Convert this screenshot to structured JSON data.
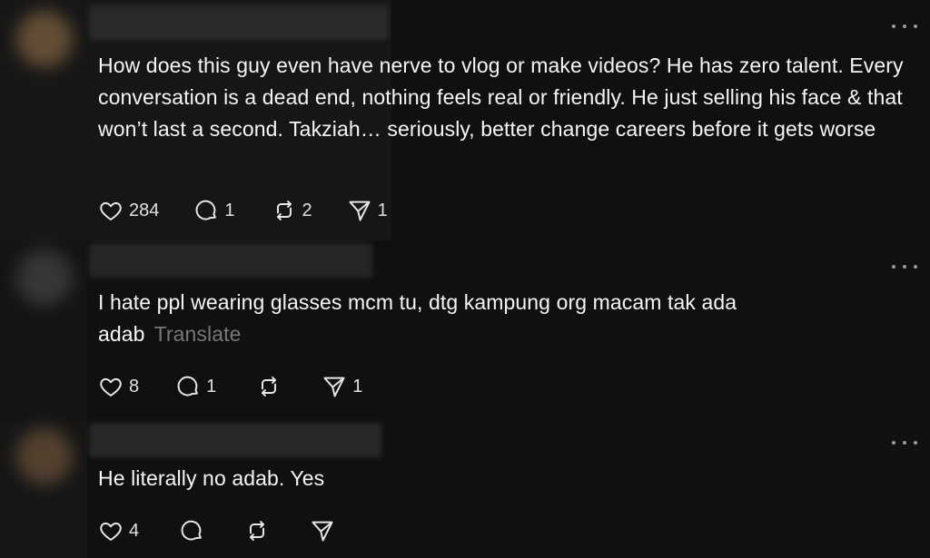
{
  "posts": [
    {
      "text": "How does this guy even have nerve to vlog or make videos? He has zero talent. Every conversation is a dead end, nothing feels real or friendly. He just selling his face & that won’t last a second. Takziah… seriously, better change careers before it gets worse",
      "translate_label": "",
      "likes": "284",
      "replies": "1",
      "reposts": "2",
      "shares": "1"
    },
    {
      "text": "I hate ppl wearing glasses mcm tu, dtg kampung org macam tak ada adab",
      "translate_label": "Translate",
      "likes": "8",
      "replies": "1",
      "reposts": "",
      "shares": "1"
    },
    {
      "text": "He literally no adab. Yes",
      "translate_label": "",
      "likes": "4",
      "replies": "",
      "reposts": "",
      "shares": ""
    }
  ],
  "icons": {
    "like": "heart-icon",
    "reply": "comment-icon",
    "repost": "repost-icon",
    "share": "send-icon",
    "more": "more-icon"
  },
  "colors": {
    "background": "#101010",
    "text": "#f3f5f7",
    "muted": "#777777"
  }
}
